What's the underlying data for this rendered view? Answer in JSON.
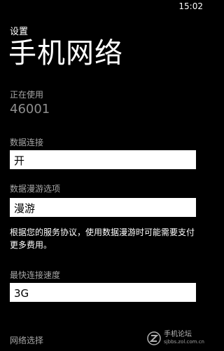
{
  "status_bar": {
    "time": "15:02"
  },
  "header": {
    "app_label": "设置",
    "title": "手机网络"
  },
  "in_use": {
    "label": "正在使用",
    "value": "46001"
  },
  "data_connection": {
    "label": "数据连接",
    "value": "开"
  },
  "data_roaming": {
    "label": "数据漫游选项",
    "value": "漫游",
    "description": "根据您的服务协议，使用数据漫游时可能需要支付更多费用。"
  },
  "highest_speed": {
    "label": "最快连接速度",
    "value": "3G"
  },
  "network_selection": {
    "label": "网络选择"
  },
  "watermark": {
    "main": "手机论坛",
    "sub": "sjbbs.zol.com.cn",
    "logo_icon": "zol-logo-icon"
  }
}
